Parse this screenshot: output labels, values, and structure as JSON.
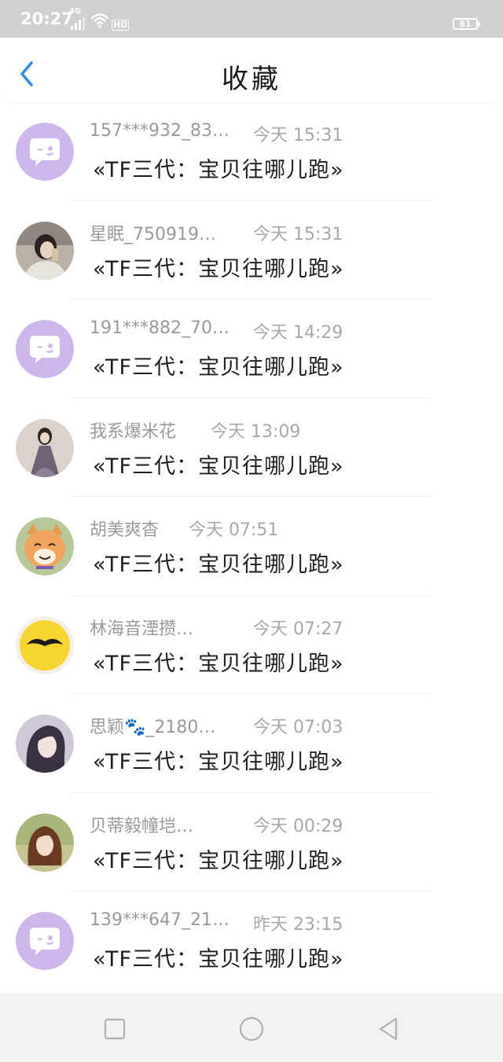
{
  "status_bar": {
    "time": "20:27",
    "network": "4G",
    "hd_label": "HD",
    "battery": "61"
  },
  "header": {
    "title": "收藏",
    "back_icon": "chevron-left-icon"
  },
  "favorites": [
    {
      "sender": "157***932_83…",
      "time": "今天 15:31",
      "title": "«TF三代：宝贝往哪儿跑»",
      "avatar": "purple-chat-bubble-icon"
    },
    {
      "sender": "星眠_750919…",
      "time": "今天 15:31",
      "title": "«TF三代：宝贝往哪儿跑»",
      "avatar": "user-photo"
    },
    {
      "sender": "191***882_70…",
      "time": "今天 14:29",
      "title": "«TF三代：宝贝往哪儿跑»",
      "avatar": "purple-chat-bubble-icon"
    },
    {
      "sender": "我系爆米花",
      "time": "今天 13:09",
      "title": "«TF三代：宝贝往哪儿跑»",
      "avatar": "user-photo"
    },
    {
      "sender": "胡美爽杳",
      "time": "今天 07:51",
      "title": "«TF三代：宝贝往哪儿跑»",
      "avatar": "cat-photo"
    },
    {
      "sender": "林海音湮攒…",
      "time": "今天 07:27",
      "title": "«TF三代：宝贝往哪儿跑»",
      "avatar": "yellow-mustache-avatar"
    },
    {
      "sender": "思颖🐾_2180…",
      "time": "今天 07:03",
      "title": "«TF三代：宝贝往哪儿跑»",
      "avatar": "user-photo"
    },
    {
      "sender": "贝蒂毅幢垲…",
      "time": "今天 00:29",
      "title": "«TF三代：宝贝往哪儿跑»",
      "avatar": "user-photo"
    },
    {
      "sender": "139***647_21…",
      "time": "昨天 23:15",
      "title": "«TF三代：宝贝往哪儿跑»",
      "avatar": "purple-chat-bubble-icon"
    }
  ],
  "bottom_nav": {
    "items": [
      "square-recents-icon",
      "circle-home-icon",
      "triangle-back-icon"
    ]
  },
  "colors": {
    "accent": "#2f8df0",
    "status_bar": "#d0d0d0",
    "bubble_purple": "#cdb7ea"
  }
}
